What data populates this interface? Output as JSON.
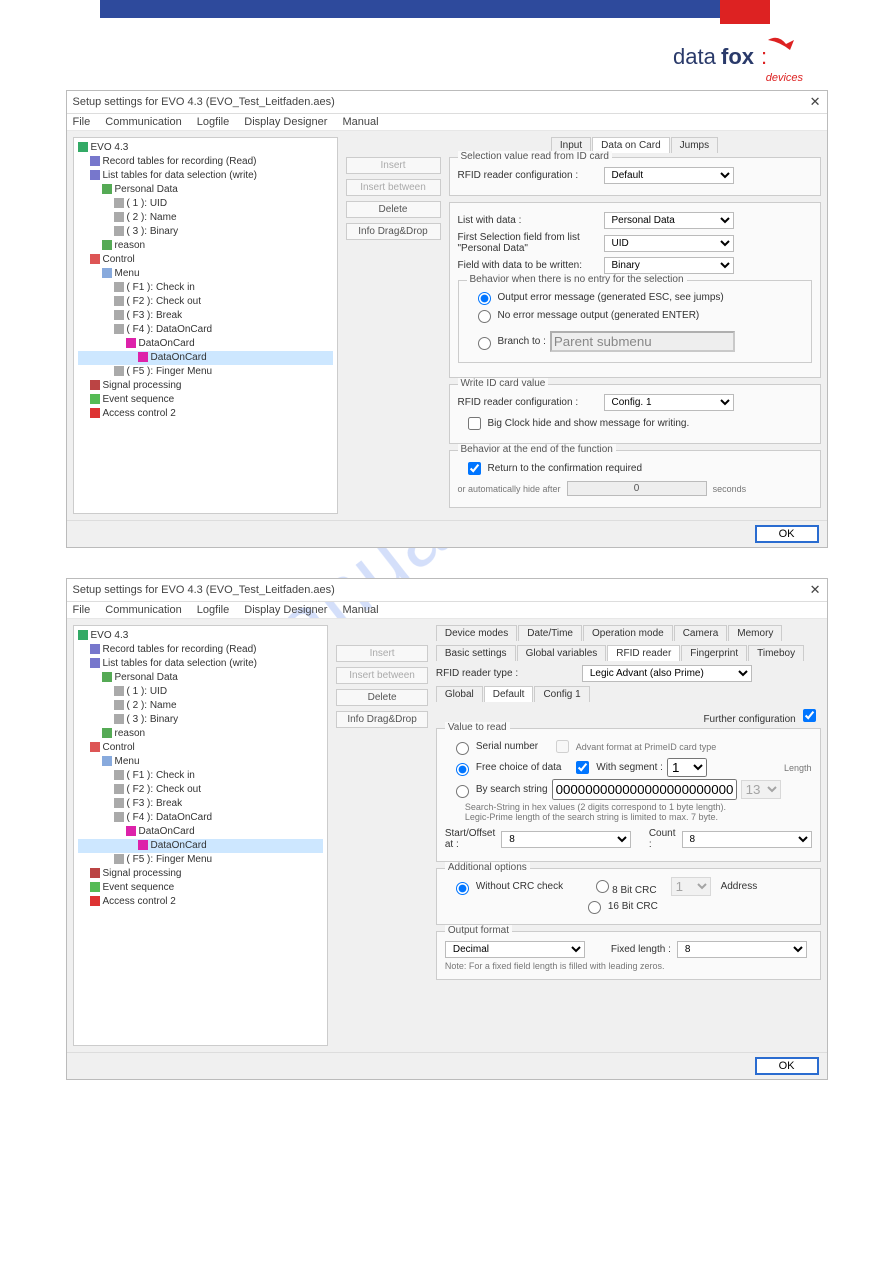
{
  "logo": {
    "name": "datafox",
    "sub": "devices"
  },
  "watermark": "manualshive.com",
  "menu": [
    "File",
    "Communication",
    "Logfile",
    "Display Designer",
    "Manual"
  ],
  "title": "Setup settings for EVO 4.3    (EVO_Test_Leitfaden.aes)",
  "tree": {
    "root": "EVO 4.3",
    "rec": "Record tables for recording (Read)",
    "lst": "List tables for data selection (write)",
    "pd": "Personal Data",
    "pd1": "( 1 ): UID",
    "pd2": "( 2 ): Name",
    "pd3": "( 3 ): Binary",
    "reason": "reason",
    "ctrl": "Control",
    "menuNode": "Menu",
    "f1": "( F1 ): Check in",
    "f2": "( F2 ): Check out",
    "f3": "( F3 ): Break",
    "f4": "( F4 ): DataOnCard",
    "doc": "DataOnCard",
    "doc2": "DataOnCard",
    "f5": "( F5 ): Finger Menu",
    "sp": "Signal processing",
    "es": "Event sequence",
    "ac": "Access control 2"
  },
  "sidebtn": {
    "insert": "Insert",
    "insertb": "Insert between",
    "delete": "Delete",
    "drag": "Info Drag&Drop"
  },
  "win1": {
    "tabs": [
      "Input",
      "Data on Card",
      "Jumps"
    ],
    "g1legend": "Selection value read from ID card",
    "g1l1": "RFID reader configuration :",
    "g1v1": "Default",
    "g2l1": "List with data :",
    "g2v1": "Personal Data",
    "g2l2": "First Selection field from list \"Personal Data\"",
    "g2v2": "UID",
    "g2l3": "Field with data to be written:",
    "g2v3": "Binary",
    "beh": "Behavior when there is no entry for the selection",
    "r1": "Output error message (generated ESC, see jumps)",
    "r2": "No error message output (generated ENTER)",
    "r3": "Branch to :",
    "r3v": "Parent submenu",
    "g3legend": "Write ID card value",
    "g3l1": "RFID reader configuration :",
    "g3v1": "Config. 1",
    "g3chk": "Big Clock hide and show message for writing.",
    "g4legend": "Behavior at the end of the function",
    "g4chk": "Return to the confirmation required",
    "g4txt": "or automatically hide after",
    "g4v": "0",
    "g4u": "seconds"
  },
  "win2": {
    "tabrows": [
      [
        "Device modes",
        "Date/Time",
        "Operation mode",
        "Camera",
        "Memory"
      ],
      [
        "Basic settings",
        "Global variables",
        "RFID reader",
        "Fingerprint",
        "Timeboy"
      ]
    ],
    "rtLbl": "RFID reader type :",
    "rtVal": "Legic Advant (also Prime)",
    "subtabs": [
      "Global",
      "Default",
      "Config 1"
    ],
    "v2legend": "Value to read",
    "furLbl": "Further configuration",
    "r_serial": "Serial number",
    "adv": "Advant format at PrimeID card type",
    "r_free": "Free choice of data",
    "withSeg": "With segment :",
    "segVal": "1",
    "lenLbl": "Length",
    "r_search": "By search string",
    "searchVal": "000000000000000000000000",
    "searchLen": "13",
    "searchNote": "Search-String in hex values (2 digits correspond to 1 byte length).\nLegic-Prime length of the search string is limited to max. 7 byte.",
    "startLbl": "Start/Offset at :",
    "startVal": "8",
    "countLbl": "Count :",
    "countVal": "8",
    "aoLegend": "Additional options",
    "r_nocrc": "Without CRC check",
    "r_8": "8 Bit CRC",
    "r_16": "16 Bit CRC",
    "addrVal": "1",
    "addrLbl": "Address",
    "ofLegend": "Output format",
    "ofVal": "Decimal",
    "fixLbl": "Fixed length :",
    "fixVal": "8",
    "ofNote": "Note: For a fixed field length is filled with leading zeros."
  },
  "ok": "OK"
}
